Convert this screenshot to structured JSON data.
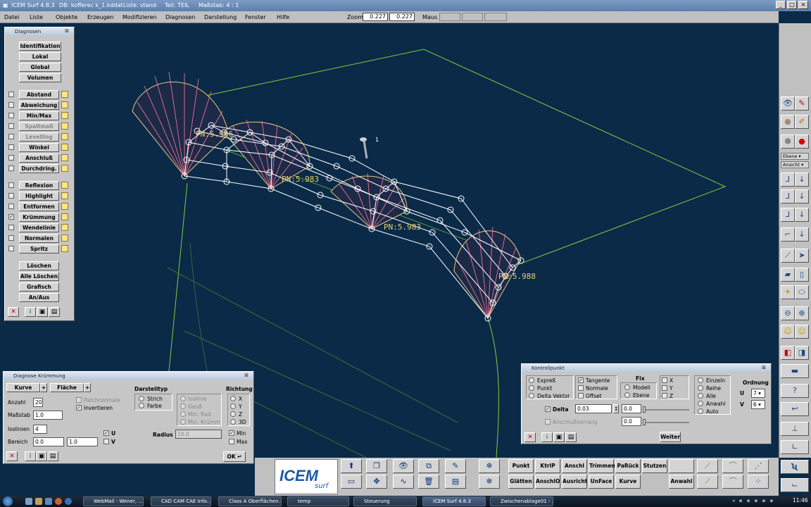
{
  "titlebar": {
    "app": "ICEM Surf 4.8.3",
    "db": "DB: kofferec k_1.kddat",
    "liste": "Liste: stand-",
    "teil": "Teil: TEIL",
    "massstab": "Maßstab: 4 : 1"
  },
  "menu": [
    "Datei",
    "Liste",
    "Objekte",
    "Erzeugen",
    "Modifizieren",
    "Diagnosen",
    "Darstellung",
    "Fenster",
    "Hilfe"
  ],
  "zoom": {
    "label": "Zoom",
    "value1": "0.227",
    "value2": "0.227",
    "maus_label": "Maus"
  },
  "viewport": {
    "point_label": "1",
    "labels": [
      "PN:5.986",
      "PN:5.983",
      "PN:5.983",
      "PN:5.988"
    ]
  },
  "diagnosen": {
    "title": "Diagnosen",
    "top_buttons": [
      "Identifikation",
      "Lokal",
      "Global",
      "Volumen"
    ],
    "group1": [
      {
        "label": "Abstand",
        "checked": false,
        "enabled": true
      },
      {
        "label": "Abweichung",
        "checked": false,
        "enabled": true
      },
      {
        "label": "Min/Max",
        "checked": false,
        "enabled": true
      },
      {
        "label": "Spaltmaß",
        "checked": false,
        "enabled": false
      },
      {
        "label": "Levelling",
        "checked": false,
        "enabled": false
      },
      {
        "label": "Winkel",
        "checked": false,
        "enabled": true
      },
      {
        "label": "Anschluß",
        "checked": false,
        "enabled": true
      },
      {
        "label": "Durchdring.",
        "checked": false,
        "enabled": true
      }
    ],
    "group2": [
      {
        "label": "Reflexion",
        "checked": false
      },
      {
        "label": "Highlight",
        "checked": false
      },
      {
        "label": "Entformen",
        "checked": false
      },
      {
        "label": "Krümmung",
        "checked": true
      },
      {
        "label": "Wendelinie",
        "checked": false
      },
      {
        "label": "Normalen",
        "checked": false
      },
      {
        "label": "Spritz",
        "checked": false
      }
    ],
    "bottom_buttons": [
      "Löschen",
      "Alle Löschen",
      "Grafisch",
      "An/Aus"
    ]
  },
  "kruemmung": {
    "title": "Diagnose Krümmung",
    "kurve": "Kurve",
    "flaeche": "Fläche",
    "anzahl_label": "Anzahl",
    "anzahl": "20",
    "massstab_label": "Maßstab",
    "massstab": "1.0",
    "isolinien_label": "Isolinien",
    "isolinien": "4",
    "bereich_label": "Bereich",
    "bereich_from": "0.0",
    "bereich_to": "1.0",
    "patchnormale": "Patchnormale",
    "invertieren": "Invertieren",
    "darstelltyp_label": "Darstelltyp",
    "strich": "Strich",
    "farbe": "Farbe",
    "isolinie": "Isolinie",
    "gauss": "Gauß",
    "min_rad": "Min. Rad",
    "min_kruemm": "Min. Krümm",
    "richtung_label": "Richtung",
    "richtungen": [
      "X",
      "Y",
      "Z",
      "3D"
    ],
    "u": "U",
    "v": "V",
    "radius_label": "Radius",
    "radius": "10.0",
    "min": "Min",
    "max": "Max",
    "ok": "OK"
  },
  "kontrollpunkt": {
    "title": "Kontrollpunkt",
    "modes": [
      "Expreß",
      "Punkt",
      "Delta Vektor"
    ],
    "tangente": "Tangente",
    "normale": "Normale",
    "offset": "Offset",
    "fix_label": "Fix",
    "modell": "Modell",
    "ebene": "Ebene",
    "axes": [
      "X",
      "Y",
      "Z"
    ],
    "selection": [
      "Einzeln",
      "Reihe",
      "Alle",
      "Anwahl",
      "Auto"
    ],
    "ordnung_label": "Ordnung",
    "ordnung_u_label": "U",
    "ordnung_u": "7",
    "ordnung_v_label": "V",
    "ordnung_v": "6",
    "delta_label": "Delta",
    "delta": "0.03",
    "delta_val": "0.0",
    "anschluss": "Anschlußvorrang",
    "anschluss_val": "0.0",
    "weiter": "Weiter"
  },
  "right_toolbar": {
    "ebene": "Ebene",
    "ansicht": "Ansicht"
  },
  "bottom": {
    "logo_main": "ICEM",
    "logo_sub": "surf",
    "row1": [
      "Punkt",
      "KtrlP",
      "Anschl",
      "Trimmen",
      "PaRück",
      "Stutzen"
    ],
    "row2": [
      "Glätten",
      "AnschlO",
      "Ausricht",
      "UnFace",
      "Kurve",
      "Anwahl"
    ]
  },
  "taskbar": {
    "items": [
      "WebMail - Wener, ...",
      "CAD CAM CAE Info...",
      "Class A Oberflächen...",
      "temp",
      "Steuerung",
      "ICEM Surf 4.8.3",
      "Zwischenablage01 - ..."
    ],
    "clock": "11:46"
  },
  "colors": {
    "viewport": "#0a2a48",
    "curvature": "#ff7a9a",
    "grid": "#7fd13a"
  }
}
